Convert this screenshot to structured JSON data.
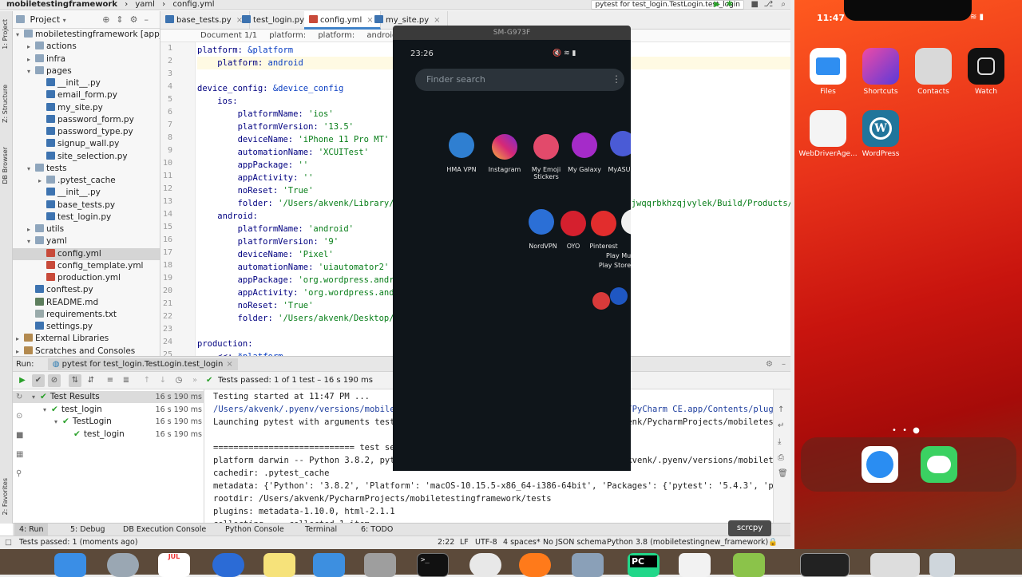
{
  "ide": {
    "title_bar": {
      "project": "mobiletestingframework",
      "crumb1": "yaml",
      "crumb2": "config.yml",
      "run_config": "pytest for test_login.TestLogin.test_login"
    },
    "left_strip": {
      "project": "1: Project",
      "structure": "Z: Structure",
      "db": "DB Browser",
      "favorites": "2: Favorites"
    },
    "project_panel": {
      "title": "Project",
      "rows": [
        {
          "label": "mobiletestingframework [app_2",
          "depth": 0,
          "type": "dir",
          "open": true
        },
        {
          "label": "actions",
          "depth": 1,
          "type": "dir",
          "open": false
        },
        {
          "label": "infra",
          "depth": 1,
          "type": "dir",
          "open": false
        },
        {
          "label": "pages",
          "depth": 1,
          "type": "dir",
          "open": true
        },
        {
          "label": "__init__.py",
          "depth": 2,
          "type": "py"
        },
        {
          "label": "email_form.py",
          "depth": 2,
          "type": "py"
        },
        {
          "label": "my_site.py",
          "depth": 2,
          "type": "py"
        },
        {
          "label": "password_form.py",
          "depth": 2,
          "type": "py"
        },
        {
          "label": "password_type.py",
          "depth": 2,
          "type": "py"
        },
        {
          "label": "signup_wall.py",
          "depth": 2,
          "type": "py"
        },
        {
          "label": "site_selection.py",
          "depth": 2,
          "type": "py"
        },
        {
          "label": "tests",
          "depth": 1,
          "type": "dir",
          "open": true
        },
        {
          "label": ".pytest_cache",
          "depth": 2,
          "type": "dir",
          "open": false
        },
        {
          "label": "__init__.py",
          "depth": 2,
          "type": "py"
        },
        {
          "label": "base_tests.py",
          "depth": 2,
          "type": "py"
        },
        {
          "label": "test_login.py",
          "depth": 2,
          "type": "py"
        },
        {
          "label": "utils",
          "depth": 1,
          "type": "dir",
          "open": false
        },
        {
          "label": "yaml",
          "depth": 1,
          "type": "dir",
          "open": true
        },
        {
          "label": "config.yml",
          "depth": 2,
          "type": "yml",
          "selected": true
        },
        {
          "label": "config_template.yml",
          "depth": 2,
          "type": "yml"
        },
        {
          "label": "production.yml",
          "depth": 2,
          "type": "yml"
        },
        {
          "label": "conftest.py",
          "depth": 1,
          "type": "py"
        },
        {
          "label": "README.md",
          "depth": 1,
          "type": "md"
        },
        {
          "label": "requirements.txt",
          "depth": 1,
          "type": "txt"
        },
        {
          "label": "settings.py",
          "depth": 1,
          "type": "py"
        },
        {
          "label": "External Libraries",
          "depth": 0,
          "type": "lib",
          "open": false
        },
        {
          "label": "Scratches and Consoles",
          "depth": 0,
          "type": "lib",
          "open": false
        }
      ]
    },
    "tabs": [
      {
        "label": "base_tests.py",
        "active": false
      },
      {
        "label": "test_login.py",
        "active": false
      },
      {
        "label": "config.yml",
        "active": true
      },
      {
        "label": "my_site.py",
        "active": false
      }
    ],
    "breadcrumb": {
      "doc": "Document 1/1",
      "b1": "platform:",
      "b2": "platform:",
      "b3": "android"
    },
    "code_lines": [
      "platform: &platform",
      "    platform: android",
      "",
      "device_config: &device_config",
      "    ios:",
      "        platformName: 'ios'",
      "        platformVersion: '13.5'",
      "        deviceName: 'iPhone 11 Pro MT'",
      "        automationName: 'XCUITest'",
      "        appPackage: ''",
      "        appActivity: ''",
      "        noReset: 'True'",
      "        folder: '/Users/akvenk/Library/Developer/Xcode/DerivedData/WordPress-bqrhnjzjhjwqqrbkhzqjvylek/Build/Products/Debug-iphonesimulator/WordPress.app'",
      "    android:",
      "        platformName: 'android'",
      "        platformVersion: '9'",
      "        deviceName: 'Pixel'",
      "        automationName: 'uiautomator2'",
      "        appPackage: 'org.wordpress.android'",
      "        appActivity: 'org.wordpress.android.ui.WPLaunchActivity'",
      "        noReset: 'True'",
      "        folder: '/Users/akvenk/Desktop/and/wordpress.apk'",
      "",
      "production:",
      "    <<: *platform"
    ],
    "line_numbers": [
      "1",
      "2",
      "3",
      "4",
      "5",
      "6",
      "7",
      "8",
      "9",
      "10",
      "11",
      "12",
      "13",
      "14",
      "15",
      "16",
      "17",
      "18",
      "19",
      "20",
      "21",
      "22",
      "23",
      "24",
      "25"
    ],
    "run": {
      "label": "Run:",
      "config": "pytest for test_login.TestLogin.test_login",
      "status": "Tests passed: 1 of 1 test – 16 s 190 ms",
      "tree": [
        {
          "label": "Test Results",
          "time": "16 s 190 ms",
          "depth": 0
        },
        {
          "label": "test_login",
          "time": "16 s 190 ms",
          "depth": 1
        },
        {
          "label": "TestLogin",
          "time": "16 s 190 ms",
          "depth": 2
        },
        {
          "label": "test_login",
          "time": "16 s 190 ms",
          "depth": 3
        }
      ],
      "console": [
        "Testing started at 11:47 PM ...",
        "/Users/akvenk/.pyenv/versions/mobiletestingnew_framework/bin/python \"/Applications/PyCharm CE.app/Contents/plugins/",
        "Launching pytest with arguments test_login.py::TestLogin::test_login in /Users/akvenk/PycharmProjects/mobiletesting",
        "",
        "============================ test session starts =============================",
        "platform darwin -- Python 3.8.2, pytest-5.4.3, py-1.9.0, pluggy-0.13.1 -- /Users/akvenk/.pyenv/versions/mobiletesti",
        "cachedir: .pytest_cache",
        "metadata: {'Python': '3.8.2', 'Platform': 'macOS-10.15.5-x86_64-i386-64bit', 'Packages': {'pytest': '5.4.3', 'py':",
        "rootdir: /Users/akvenk/PycharmProjects/mobiletestingframework/tests",
        "plugins: metadata-1.10.0, html-2.1.1",
        "collecting ... collected 1 item"
      ]
    },
    "bottom_tabs": [
      "4: Run",
      "5: Debug",
      "DB Execution Console",
      "Python Console",
      "Terminal",
      "6: TODO"
    ],
    "status_bar": {
      "message": "Tests passed: 1 (moments ago)",
      "position": "2:22",
      "line_sep": "LF",
      "encoding": "UTF-8",
      "indent": "4 spaces*",
      "schema": "No JSON schema",
      "interpreter": "Python 3.8 (mobiletestingnew_framework)"
    }
  },
  "android": {
    "window_title": "SM-G973F",
    "time": "23:26",
    "search_placeholder": "Finder search",
    "row1": [
      "HMA VPN",
      "Instagram",
      "My Emoji Stickers",
      "My Galaxy",
      "MyASUS"
    ],
    "row2": [
      "NordVPN",
      "OYO",
      "Pinterest",
      "Play Music",
      "Play Store"
    ],
    "tooltip": "scrcpy"
  },
  "ios": {
    "time": "11:47",
    "apps": [
      "Files",
      "Shortcuts",
      "Contacts",
      "Watch",
      "WebDriverAge...",
      "WordPress"
    ]
  },
  "colors": {
    "accent": "#4083c9",
    "pass_green": "#2aa02a",
    "string_green": "#067d17",
    "keyword_blue": "#000080"
  }
}
